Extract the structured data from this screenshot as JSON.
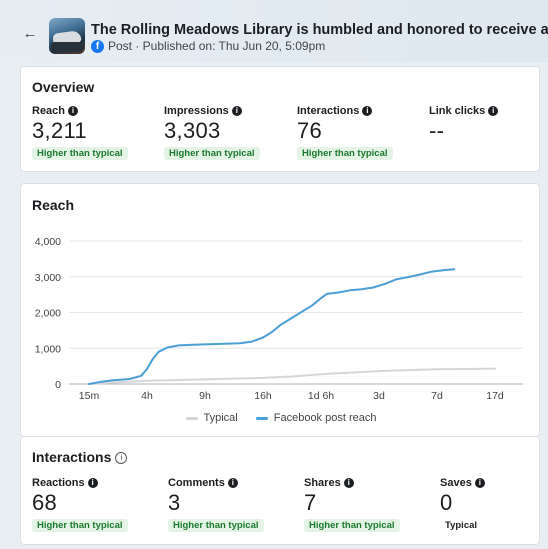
{
  "post": {
    "title": "The Rolling Meadows Library is humbled and honored to receive a sizable donation from",
    "meta": "Post · Published on: Thu Jun 20, 5:09pm"
  },
  "overview": {
    "title": "Overview",
    "metrics": [
      {
        "label": "Reach",
        "value": "3,211",
        "badge": "Higher than typical"
      },
      {
        "label": "Impressions",
        "value": "3,303",
        "badge": "Higher than typical"
      },
      {
        "label": "Interactions",
        "value": "76",
        "badge": "Higher than typical"
      },
      {
        "label": "Link clicks",
        "value": "--",
        "badge": ""
      }
    ]
  },
  "reach": {
    "title": "Reach"
  },
  "interactions": {
    "title": "Interactions",
    "metrics": [
      {
        "label": "Reactions",
        "value": "68",
        "badge": "Higher than typical"
      },
      {
        "label": "Comments",
        "value": "3",
        "badge": "Higher than typical"
      },
      {
        "label": "Shares",
        "value": "7",
        "badge": "Higher than typical"
      },
      {
        "label": "Saves",
        "value": "0",
        "badge": "Typical"
      }
    ]
  },
  "colors": {
    "reach_line": "#4a9fd6",
    "typical_line": "#d4d6d9",
    "badge_bg": "#e4f3e6",
    "badge_text": "#1a7a2e"
  },
  "chart_data": {
    "type": "line",
    "x_ticks": [
      "15m",
      "4h",
      "9h",
      "16h",
      "1d 6h",
      "3d",
      "7d",
      "17d"
    ],
    "y_ticks": [
      "4,000",
      "3,000",
      "2,000",
      "1,000",
      "0"
    ],
    "ylim": [
      0,
      4000
    ],
    "grid": true,
    "legend_position": "bottom",
    "series": [
      {
        "name": "Typical",
        "color": "#d4d6d9",
        "points": [
          [
            0,
            0
          ],
          [
            0.4,
            40
          ],
          [
            1,
            90
          ],
          [
            1.5,
            110
          ],
          [
            2,
            130
          ],
          [
            2.5,
            150
          ],
          [
            3,
            170
          ],
          [
            3.5,
            210
          ],
          [
            4,
            270
          ],
          [
            4.5,
            320
          ],
          [
            5,
            360
          ],
          [
            5.5,
            390
          ],
          [
            6,
            410
          ],
          [
            6.5,
            420
          ],
          [
            7,
            430
          ]
        ]
      },
      {
        "name": "Facebook post reach",
        "color": "#4a9fd6",
        "points": [
          [
            0,
            0
          ],
          [
            0.2,
            60
          ],
          [
            0.4,
            100
          ],
          [
            0.7,
            140
          ],
          [
            0.9,
            230
          ],
          [
            1.0,
            420
          ],
          [
            1.1,
            700
          ],
          [
            1.2,
            900
          ],
          [
            1.35,
            1020
          ],
          [
            1.55,
            1080
          ],
          [
            1.8,
            1100
          ],
          [
            2.2,
            1120
          ],
          [
            2.6,
            1140
          ],
          [
            2.8,
            1180
          ],
          [
            3.0,
            1300
          ],
          [
            3.15,
            1450
          ],
          [
            3.3,
            1650
          ],
          [
            3.5,
            1850
          ],
          [
            3.7,
            2050
          ],
          [
            3.85,
            2200
          ],
          [
            4.0,
            2400
          ],
          [
            4.1,
            2520
          ],
          [
            4.3,
            2560
          ],
          [
            4.5,
            2620
          ],
          [
            4.7,
            2650
          ],
          [
            4.9,
            2700
          ],
          [
            5.1,
            2800
          ],
          [
            5.3,
            2930
          ],
          [
            5.5,
            2990
          ],
          [
            5.7,
            3060
          ],
          [
            5.9,
            3140
          ],
          [
            6.1,
            3180
          ],
          [
            6.3,
            3211
          ]
        ]
      }
    ]
  }
}
